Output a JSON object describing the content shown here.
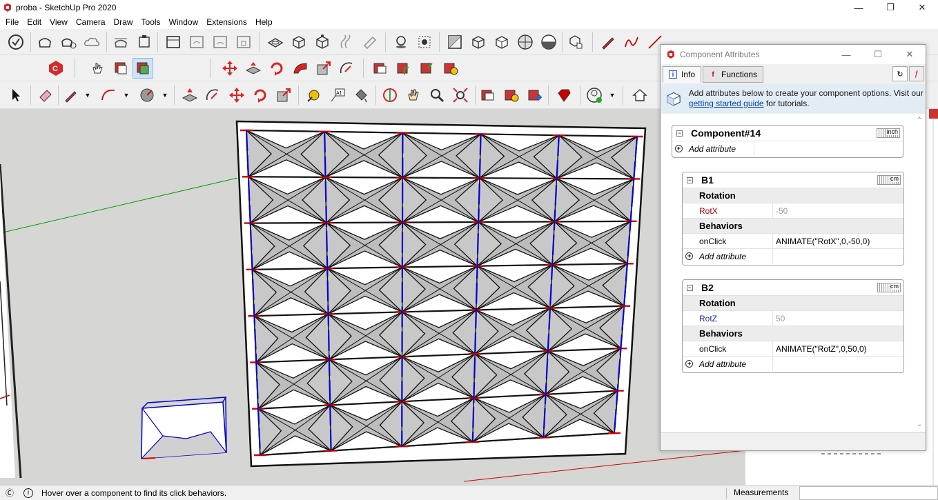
{
  "window": {
    "title": "proba - SketchUp Pro 2020"
  },
  "menu": [
    "File",
    "Edit",
    "View",
    "Camera",
    "Draw",
    "Tools",
    "Window",
    "Extensions",
    "Help"
  ],
  "colors": {
    "axis_red": "#cc0000",
    "axis_green": "#00a000",
    "axis_blue": "#0000cc",
    "viewport_bg": "#d6d6d4"
  },
  "status": {
    "hint": "Hover over a component to find its click behaviors.",
    "measurements_label": "Measurements"
  },
  "panel": {
    "title": "Component Attributes",
    "tabs": {
      "info": "Info",
      "functions": "Functions"
    },
    "banner": {
      "text_before": "Add attributes below to create your component options. Visit our ",
      "link": "getting started guide",
      "text_after": " for tutorials."
    },
    "component": {
      "name": "Component#14",
      "unit": "inch",
      "add_attribute": "Add attribute"
    },
    "b1": {
      "name": "B1",
      "unit": "cm",
      "group1": "Rotation",
      "attr1_name": "RotX",
      "attr1_value": "-50",
      "group2": "Behaviors",
      "attr2_name": "onClick",
      "attr2_value": "ANIMATE(\"RotX\",0,-50,0)",
      "add_attribute": "Add attribute"
    },
    "b2": {
      "name": "B2",
      "unit": "cm",
      "group1": "Rotation",
      "attr1_name": "RotZ",
      "attr1_value": "50",
      "group2": "Behaviors",
      "attr2_name": "onClick",
      "attr2_value": "ANIMATE(\"RotZ\",0,50,0)",
      "add_attribute": "Add attribute"
    }
  }
}
